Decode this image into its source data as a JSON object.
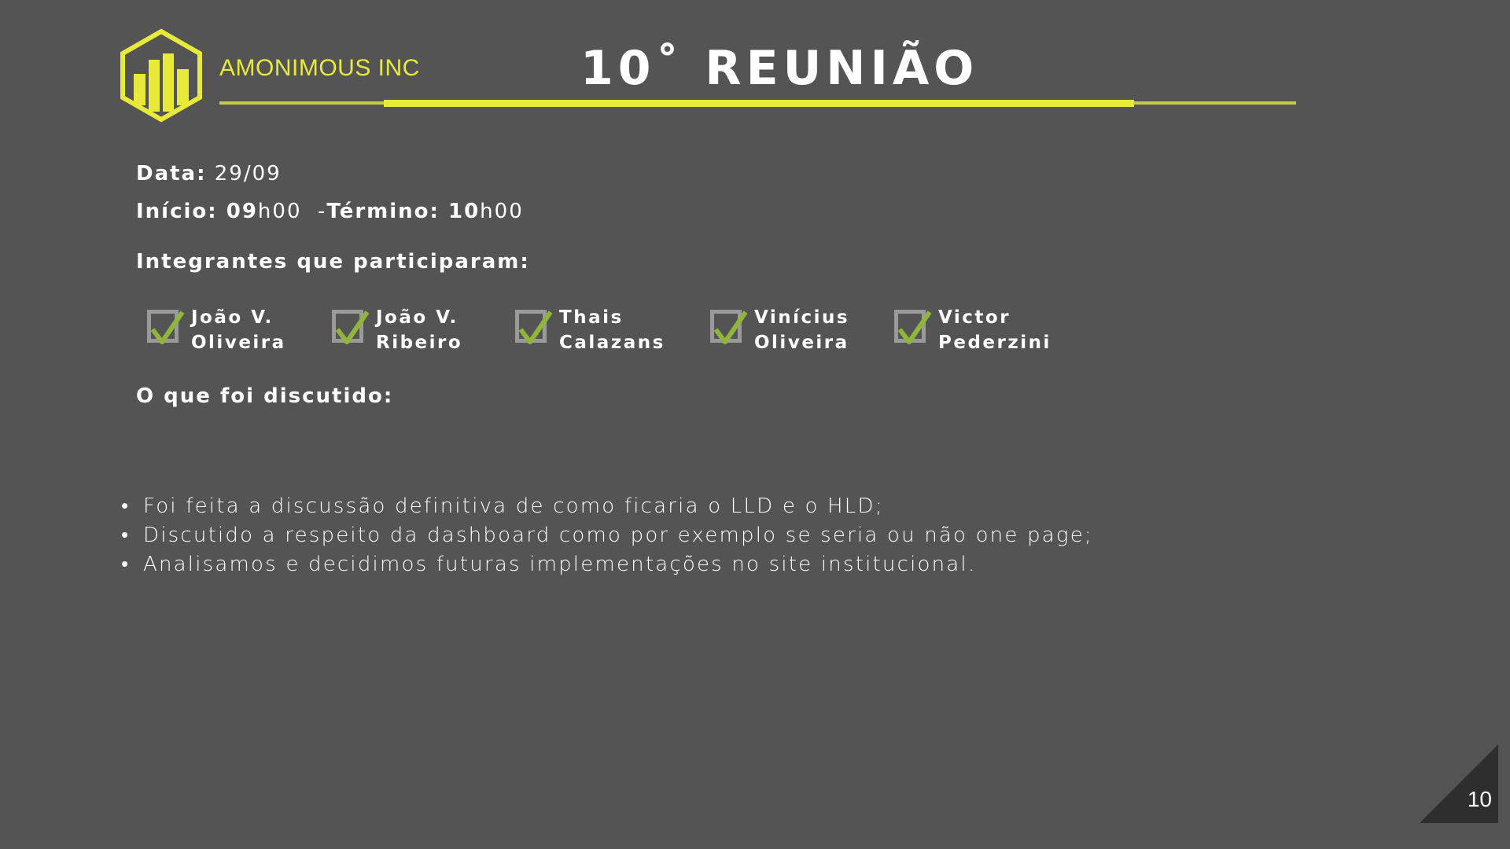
{
  "header": {
    "company": "AMONIMOUS INC",
    "title": "10˚ REUNIÃO",
    "accent_color": "#e8ea3a"
  },
  "info": {
    "date_label": "Data:",
    "date_value": " 29/09",
    "start_label": "Início: ",
    "start_hour": "09",
    "start_rest": "h00",
    "sep": "  -",
    "end_label": "Término: ",
    "end_hour": "10",
    "end_rest": "h00",
    "members_label": "Integrantes que participaram:",
    "discussed_label": "O que foi discutido:"
  },
  "members": [
    {
      "line1": "João V.",
      "line2": "Oliveira",
      "checked": true
    },
    {
      "line1": "João V.",
      "line2": "Ribeiro",
      "checked": true
    },
    {
      "line1": "Thais",
      "line2": "Calazans",
      "checked": true
    },
    {
      "line1": "Vinícius",
      "line2": "Oliveira",
      "checked": true
    },
    {
      "line1": "Victor",
      "line2": "Pederzini",
      "checked": true
    }
  ],
  "topics": [
    "Foi feita a discussão definitiva de como ficaria o LLD e o HLD;",
    "Discutido a respeito da dashboard como por exemplo se seria ou não one page;",
    "Analisamos e decidimos futuras implementações no site institucional."
  ],
  "page_number": "10",
  "icons": {
    "logo": "bar-chart-hexagon-icon",
    "check": "checkmark-icon"
  }
}
